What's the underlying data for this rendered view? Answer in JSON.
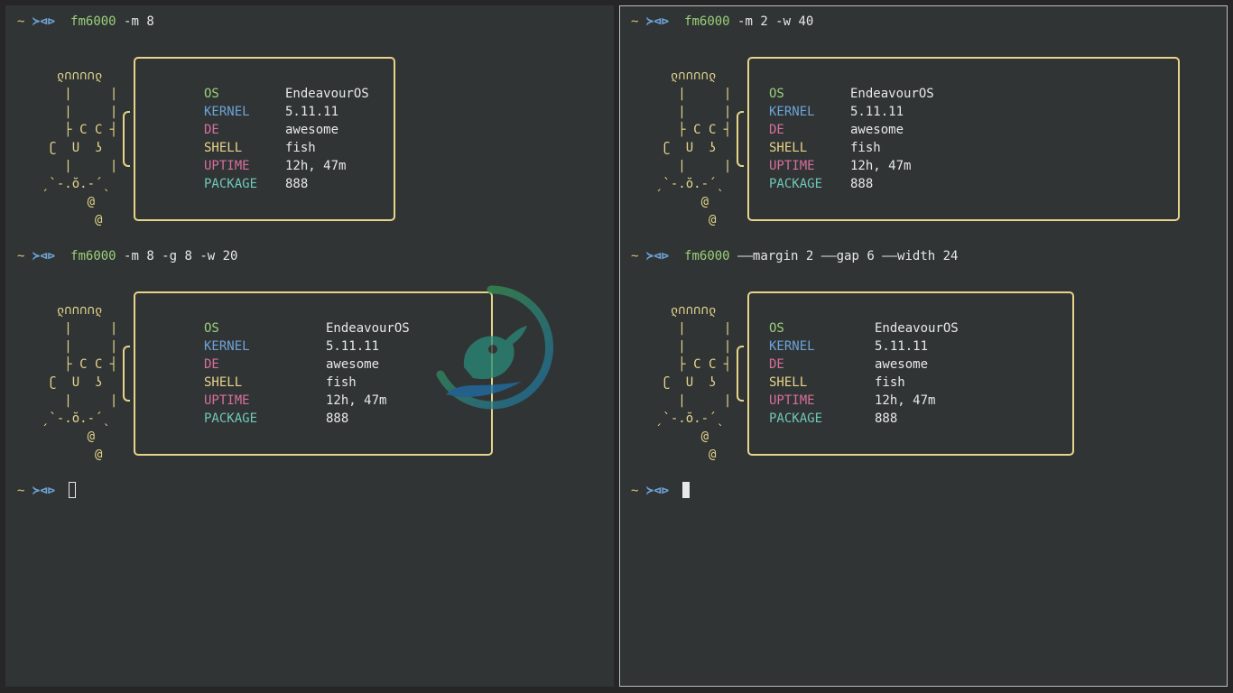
{
  "prompt": {
    "tilde": "~",
    "arrows": "≻⊲⊳"
  },
  "info_rows": [
    {
      "key": "OS",
      "value": "EndeavourOS",
      "color": "#9bcf7a"
    },
    {
      "key": "KERNEL",
      "value": "5.11.11",
      "color": "#6da3d6"
    },
    {
      "key": "DE",
      "value": "awesome",
      "color": "#d76f9a"
    },
    {
      "key": "SHELL",
      "value": "fish",
      "color": "#e8d488"
    },
    {
      "key": "UPTIME",
      "value": "12h, 47m",
      "color": "#d76f9a"
    },
    {
      "key": "PACKAGE",
      "value": "888",
      "color": "#70c7b5"
    }
  ],
  "ascii_art": [
    "ლ∩∩∩∩ლ",
    "|     |",
    "|     |",
    "├ C C ┤",
    "ʗ  U  ʖ",
    "|     |",
    "ˏ`-.ŏ.-´ˎ",
    "@",
    "@"
  ],
  "left_pane": {
    "commands": [
      {
        "cmd": "fm6000",
        "args": " -m 8"
      },
      {
        "cmd": "fm6000",
        "args": " -m 8 -g 8 -w 20"
      }
    ]
  },
  "right_pane": {
    "commands": [
      {
        "cmd": "fm6000",
        "args": " -m 2 -w 40"
      },
      {
        "cmd": "fm6000",
        "args": " ——margin 2 ——gap 6 ——width 24"
      }
    ]
  },
  "colors": {
    "background": "#303435",
    "box_border": "#e8d488",
    "prompt_arrows": "#6da3d6",
    "command": "#9bcf7a"
  }
}
